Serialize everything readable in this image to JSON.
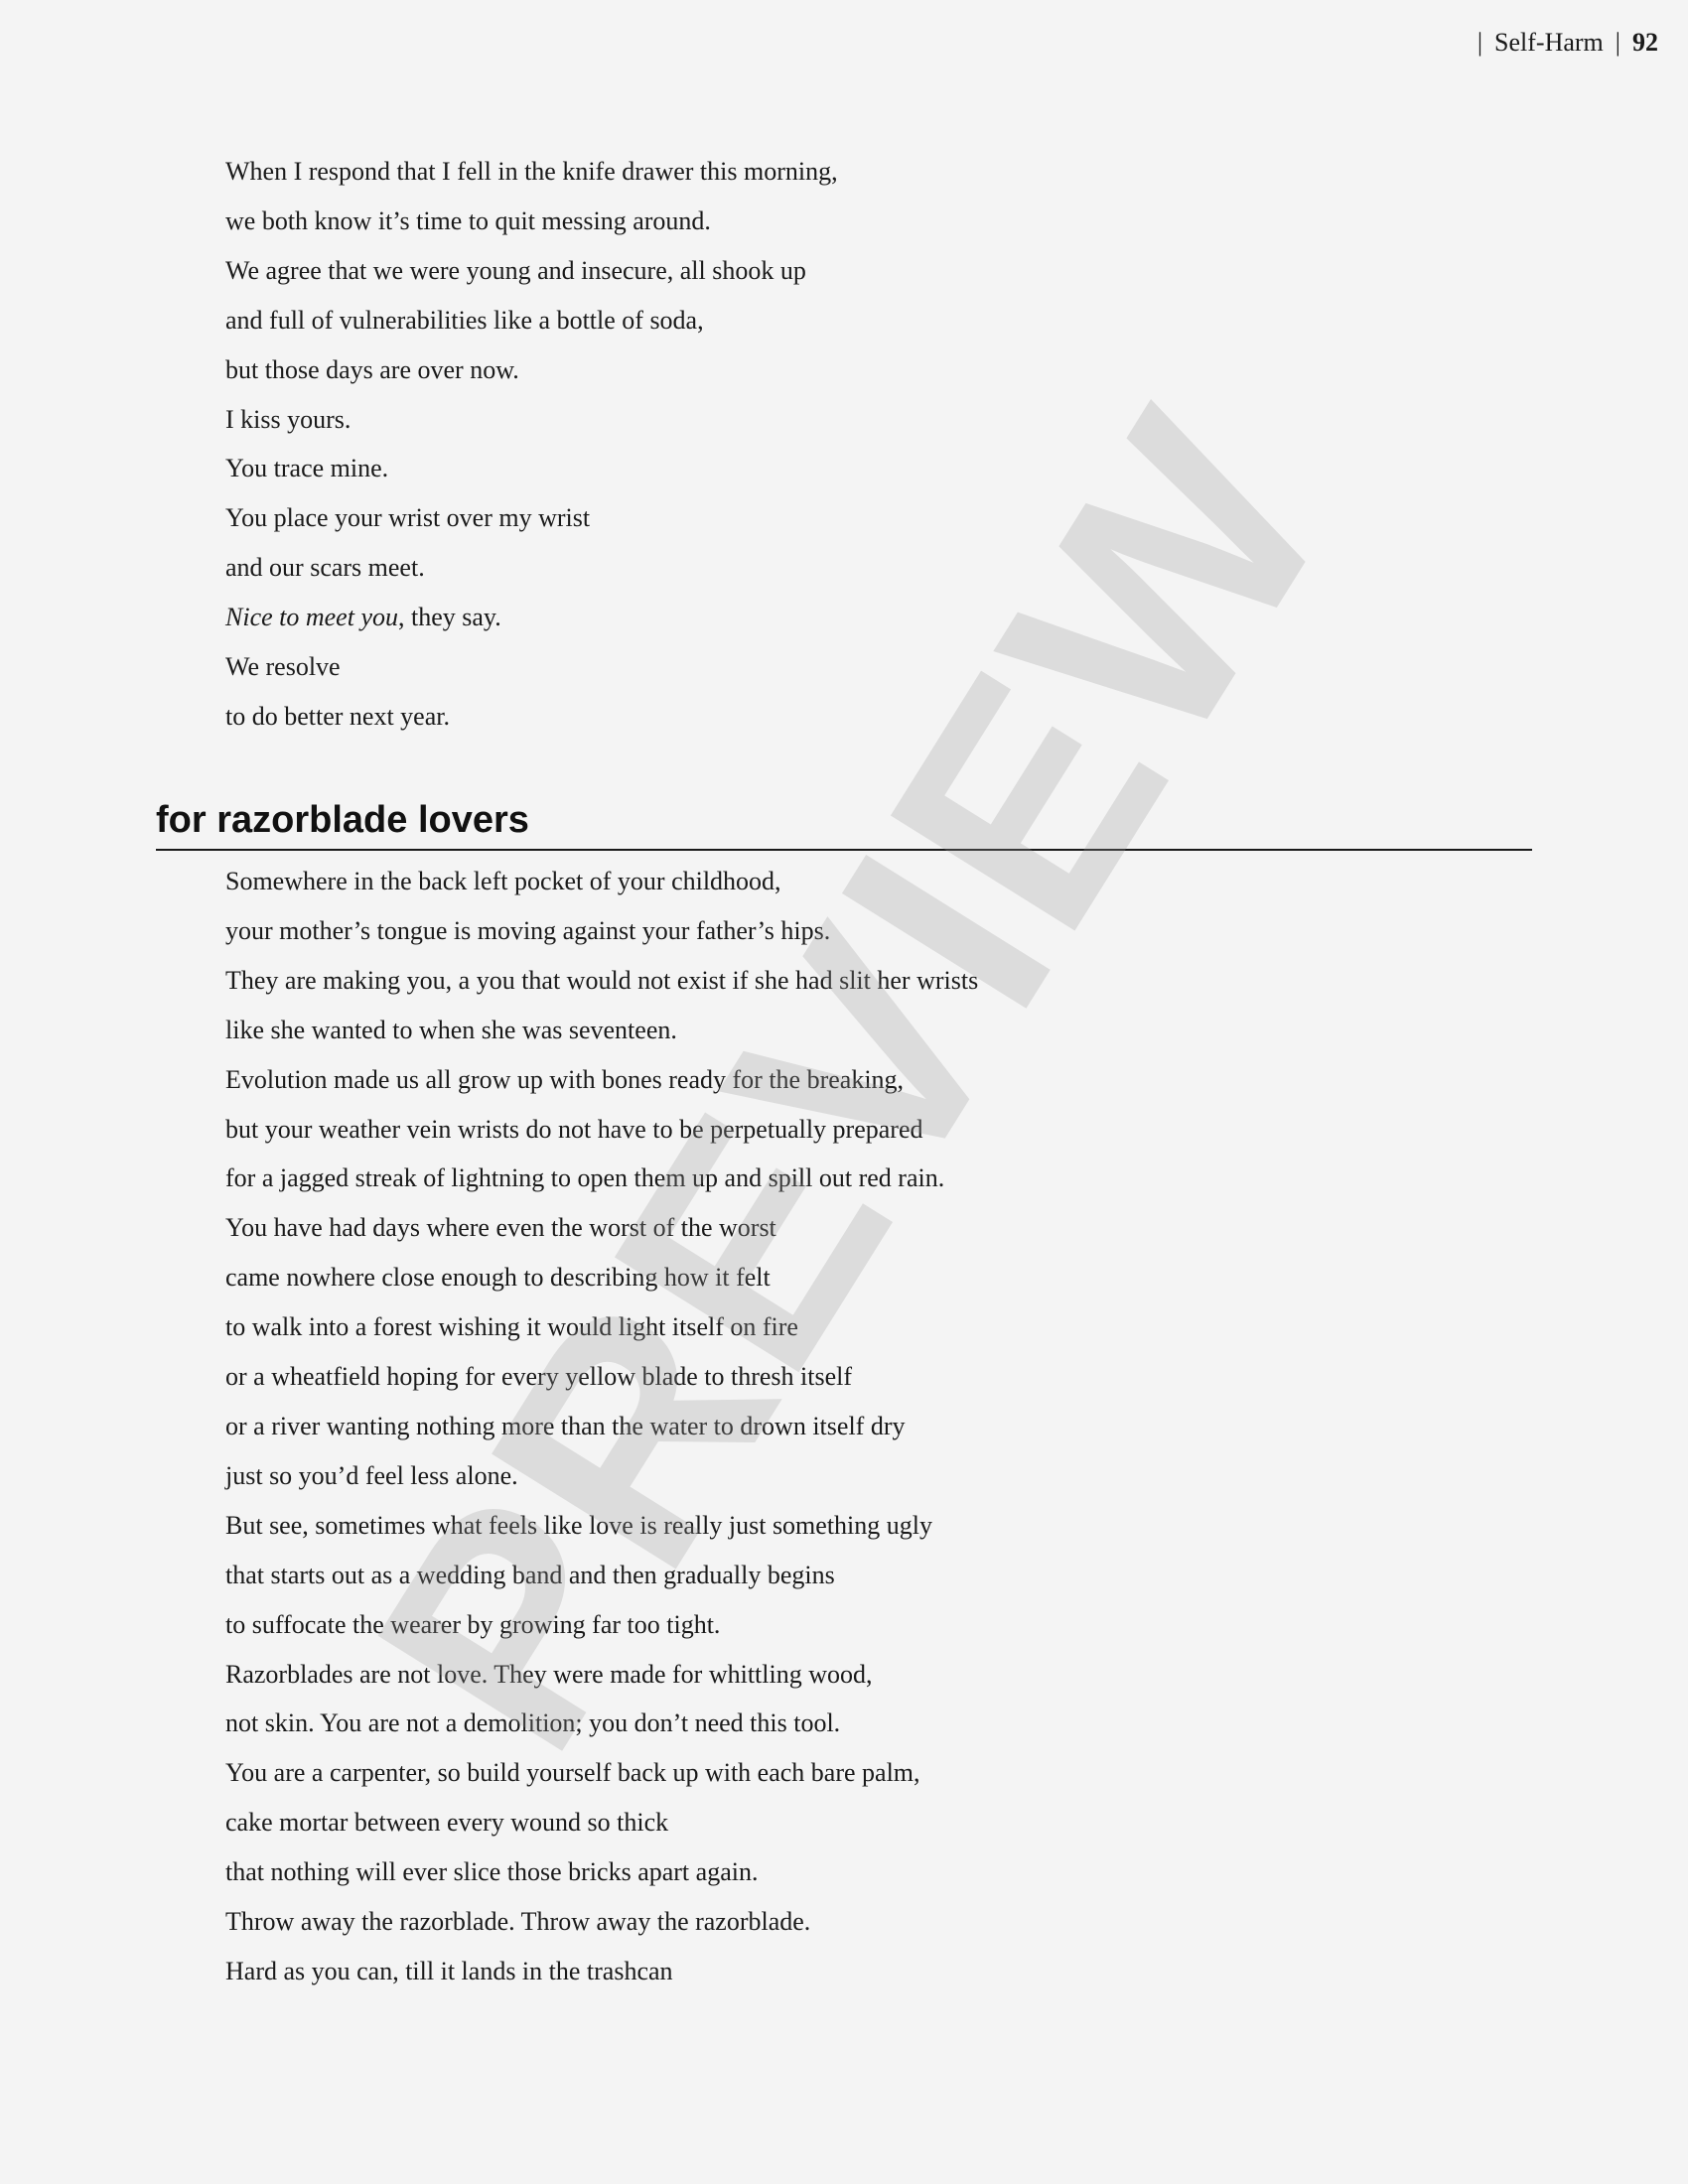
{
  "header": {
    "separator": "|",
    "section": "Self-Harm",
    "page_number": "92"
  },
  "poem1": {
    "lines": [
      "When I respond that I fell in the knife drawer this morning,",
      "we both know it’s time to quit messing around.",
      "We agree that we were young and insecure, all shook up",
      "and full of vulnerabilities like a bottle of soda,",
      "but those days are over now.",
      "I kiss yours.",
      "You trace mine.",
      "You place your wrist over my wrist",
      "and our scars meet."
    ],
    "italic_phrase": "Nice to meet you",
    "italic_line_rest": ", they say.",
    "closing_lines": [
      "We resolve",
      "to do better next year."
    ]
  },
  "section": {
    "title": "for razorblade lovers"
  },
  "poem2": {
    "lines": [
      "Somewhere in the back left pocket of your childhood,",
      "your mother’s tongue is moving against your father’s hips.",
      "They are making you, a you that would not exist if she had slit her wrists",
      "like she wanted to when she was seventeen.",
      "Evolution made us all grow up with bones ready for the breaking,",
      "but your weather vein wrists do not have to be perpetually prepared",
      "for a jagged streak of lightning to open them up and spill out red rain.",
      "You have had days where even the worst of the worst",
      "came nowhere close enough to describing how it felt",
      "to walk into a forest wishing it would light itself on fire",
      "or a wheatfield hoping for every yellow blade to thresh itself",
      "or a river wanting nothing more than the water to drown itself dry",
      "just so you’d feel less alone.",
      "But see, sometimes what feels like love is really just something ugly",
      "that starts out as a wedding band and then gradually begins",
      "to suffocate the wearer by growing far too tight.",
      "Razorblades are not love. They were made for whittling wood,",
      "not skin.  You are not a demolition; you don’t need this tool.",
      "You are a carpenter, so build yourself back up with each bare palm,",
      "cake mortar between every wound so thick",
      "that nothing will ever slice those bricks apart again.",
      "Throw away the razorblade. Throw away the razorblade.",
      "Hard as you can, till it lands in the trashcan"
    ]
  },
  "watermark": {
    "text": "PREVIEW",
    "color": "#969696"
  }
}
